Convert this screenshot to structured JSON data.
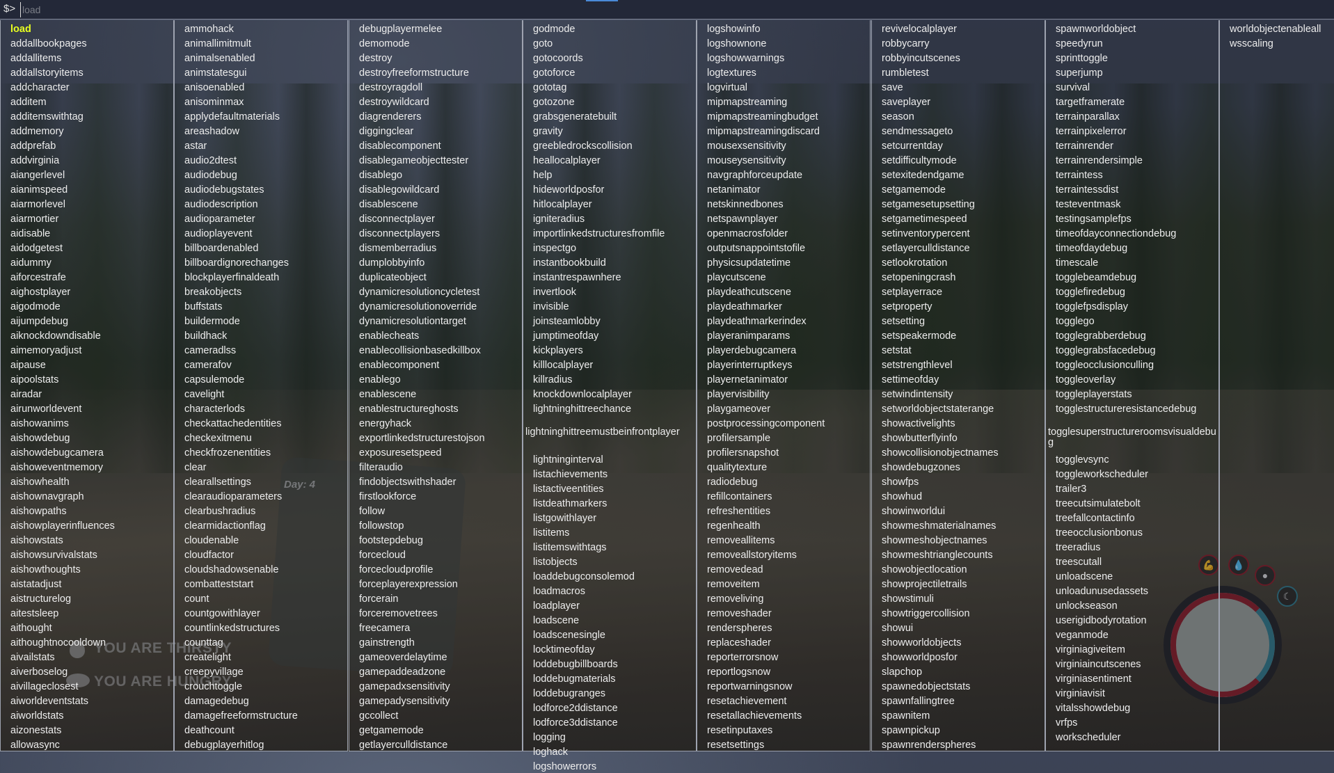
{
  "console": {
    "prompt": "$>",
    "input_value": "",
    "input_placeholder": "load",
    "selected_command": "load"
  },
  "columns": [
    [
      "load",
      "addallbookpages",
      "addallitems",
      "addallstoryitems",
      "addcharacter",
      "additem",
      "additemswithtag",
      "addmemory",
      "addprefab",
      "addvirginia",
      "aiangerlevel",
      "aianimspeed",
      "aiarmorlevel",
      "aiarmortier",
      "aidisable",
      "aidodgetest",
      "aidummy",
      "aiforcestrafe",
      "aighostplayer",
      "aigodmode",
      "aijumpdebug",
      "aiknockdowndisable",
      "aimemoryadjust",
      "aipause",
      "aipoolstats",
      "airadar",
      "airunworldevent",
      "aishowanims",
      "aishowdebug",
      "aishowdebugcamera",
      "aishoweventmemory",
      "aishowhealth",
      "aishownavgraph",
      "aishowpaths",
      "aishowplayerinfluences",
      "aishowstats",
      "aishowsurvivalstats",
      "aishowthoughts",
      "aistatadjust",
      "aistructurelog",
      "aitestsleep",
      "aithought",
      "aithoughtnocooldown",
      "aivailstats",
      "aiverboselog",
      "aivillageclosest",
      "aiworldeventstats",
      "aiworldstats",
      "aizonestats",
      "allowasync"
    ],
    [
      "ammohack",
      "animallimitmult",
      "animalsenabled",
      "animstatesgui",
      "anisoenabled",
      "anisominmax",
      "applydefaultmaterials",
      "areashadow",
      "astar",
      "audio2dtest",
      "audiodebug",
      "audiodebugstates",
      "audiodescription",
      "audioparameter",
      "audioplayevent",
      "billboardenabled",
      "billboardignorechanges",
      "blockplayerfinaldeath",
      "breakobjects",
      "buffstats",
      "buildermode",
      "buildhack",
      "cameradlss",
      "camerafov",
      "capsulemode",
      "cavelight",
      "characterlods",
      "checkattachedentities",
      "checkexitmenu",
      "checkfrozenentities",
      "clear",
      "clearallsettings",
      "clearaudioparameters",
      "clearbushradius",
      "clearmidactionflag",
      "cloudenable",
      "cloudfactor",
      "cloudshadowsenable",
      "combatteststart",
      "count",
      "countgowithlayer",
      "countlinkedstructures",
      "counttag",
      "createlight",
      "creepyvillage",
      "crouchtoggle",
      "damagedebug",
      "damagefreeformstructure",
      "deathcount",
      "debugplayerhitlog"
    ],
    [
      "debugplayermelee",
      "demomode",
      "destroy",
      "destroyfreeformstructure",
      "destroyragdoll",
      "destroywildcard",
      "diagrenderers",
      "diggingclear",
      "disablecomponent",
      "disablegameobjecttester",
      "disablego",
      "disablegowildcard",
      "disablescene",
      "disconnectplayer",
      "disconnectplayers",
      "dismemberradius",
      "dumplobbyinfo",
      "duplicateobject",
      "dynamicresolutioncycletest",
      "dynamicresolutionoverride",
      "dynamicresolutiontarget",
      "enablecheats",
      "enablecollisionbasedkillbox",
      "enablecomponent",
      "enablego",
      "enablescene",
      "enablestructureghosts",
      "energyhack",
      "exportlinkedstructurestojson",
      "exposuresetspeed",
      "filteraudio",
      "findobjectswithshader",
      "firstlookforce",
      "follow",
      "followstop",
      "footstepdebug",
      "forcecloud",
      "forcecloudprofile",
      "forceplayerexpression",
      "forcerain",
      "forceremovetrees",
      "freecamera",
      "gainstrength",
      "gameoverdelaytime",
      "gamepaddeadzone",
      "gamepadxsensitivity",
      "gamepadysensitivity",
      "gccollect",
      "getgamemode",
      "getlayerculldistance"
    ],
    [
      "godmode",
      "goto",
      "gotocoords",
      "gotoforce",
      "gototag",
      "gotozone",
      "grabsgeneratebuilt",
      "gravity",
      "greebledrockscollision",
      "heallocalplayer",
      "help",
      "hideworldposfor",
      "hitlocalplayer",
      "igniteradius",
      "importlinkedstructuresfromfile",
      "inspectgo",
      "instantbookbuild",
      "instantrespawnhere",
      "invertlook",
      "invisible",
      "joinsteamlobby",
      "jumptimeofday",
      "kickplayers",
      "killlocalplayer",
      "killradius",
      "knockdownlocalplayer",
      "lightninghittreechance",
      "lightninghittreemustbeinfrontplayer",
      "lightninginterval",
      "listachievements",
      "listactiveentities",
      "listdeathmarkers",
      "listgowithlayer",
      "listitems",
      "listitemswithtags",
      "listobjects",
      "loaddebugconsolemod",
      "loadmacros",
      "loadplayer",
      "loadscene",
      "loadscenesingle",
      "locktimeofday",
      "loddebugbillboards",
      "loddebugmaterials",
      "loddebugranges",
      "lodforce2ddistance",
      "lodforce3ddistance",
      "logging",
      "loghack",
      "logshowerrors"
    ],
    [
      "logshowinfo",
      "logshownone",
      "logshowwarnings",
      "logtextures",
      "logvirtual",
      "mipmapstreaming",
      "mipmapstreamingbudget",
      "mipmapstreamingdiscard",
      "mousexsensitivity",
      "mouseysensitivity",
      "navgraphforceupdate",
      "netanimator",
      "netskinnedbones",
      "netspawnplayer",
      "openmacrosfolder",
      "outputsnappointstofile",
      "physicsupdatetime",
      "playcutscene",
      "playdeathcutscene",
      "playdeathmarker",
      "playdeathmarkerindex",
      "playeranimparams",
      "playerdebugcamera",
      "playerinterruptkeys",
      "playernetanimator",
      "playervisibility",
      "playgameover",
      "postprocessingcomponent",
      "profilersample",
      "profilersnapshot",
      "qualitytexture",
      "radiodebug",
      "refillcontainers",
      "refreshentities",
      "regenhealth",
      "removeallitems",
      "removeallstoryitems",
      "removedead",
      "removeitem",
      "removeliving",
      "removeshader",
      "renderspheres",
      "replaceshader",
      "reporterrorsnow",
      "reportlogsnow",
      "reportwarningsnow",
      "resetachievement",
      "resetallachievements",
      "resetinputaxes",
      "resetsettings"
    ],
    [
      "revivelocalplayer",
      "robbycarry",
      "robbyincutscenes",
      "rumbletest",
      "save",
      "saveplayer",
      "season",
      "sendmessageto",
      "setcurrentday",
      "setdifficultymode",
      "setexitedendgame",
      "setgamemode",
      "setgamesetupsetting",
      "setgametimespeed",
      "setinventorypercent",
      "setlayerculldistance",
      "setlookrotation",
      "setopeningcrash",
      "setplayerrace",
      "setproperty",
      "setsetting",
      "setspeakermode",
      "setstat",
      "setstrengthlevel",
      "settimeofday",
      "setwindintensity",
      "setworldobjectstaterange",
      "showactivelights",
      "showbutterflyinfo",
      "showcollisionobjectnames",
      "showdebugzones",
      "showfps",
      "showhud",
      "showinworldui",
      "showmeshmaterialnames",
      "showmeshobjectnames",
      "showmeshtrianglecounts",
      "showobjectlocation",
      "showprojectiletrails",
      "showstimuli",
      "showtriggercollision",
      "showui",
      "showworldobjects",
      "showworldposfor",
      "slapchop",
      "spawnedobjectstats",
      "spawnfallingtree",
      "spawnitem",
      "spawnpickup",
      "spawnrenderspheres"
    ],
    [
      "spawnworldobject",
      "speedyrun",
      "sprinttoggle",
      "superjump",
      "survival",
      "targetframerate",
      "terrainparallax",
      "terrainpixelerror",
      "terrainrender",
      "terrainrendersimple",
      "terraintess",
      "terraintessdist",
      "testeventmask",
      "testingsamplefps",
      "timeofdayconnectiondebug",
      "timeofdaydebug",
      "timescale",
      "togglebeamdebug",
      "togglefiredebug",
      "togglefpsdisplay",
      "togglego",
      "togglegrabberdebug",
      "togglegrabsfacedebug",
      "toggleocclusionculling",
      "toggleoverlay",
      "toggleplayerstats",
      "togglestructureresistancedebug",
      "togglesuperstructureroomsvisualdebug",
      "togglevsync",
      "toggleworkscheduler",
      "trailer3",
      "treecutsimulatebolt",
      "treefallcontactinfo",
      "treeocclusionbonus",
      "treeradius",
      "treescutall",
      "unloadscene",
      "unloadunusedassets",
      "unlockseason",
      "userigidbodyrotation",
      "veganmode",
      "virginiagiveitem",
      "virginiaincutscenes",
      "virginiasentiment",
      "virginiavisit",
      "vitalsshowdebug",
      "vrfps",
      "workscheduler"
    ],
    [
      "worldobjectenableall",
      "wsscaling"
    ]
  ],
  "hud": {
    "thirsty_text": "YOU ARE THIRSTY",
    "hungry_text": "YOU ARE HUNGRY",
    "gps_day": "Day: 4",
    "icons": [
      "water-drop-icon",
      "stomach-icon",
      "strength-arm-icon",
      "sleep-moon-icon"
    ],
    "colors": {
      "selected": "#e8ff20",
      "text": "#ededed",
      "health_ring": "#8a1a24"
    }
  }
}
